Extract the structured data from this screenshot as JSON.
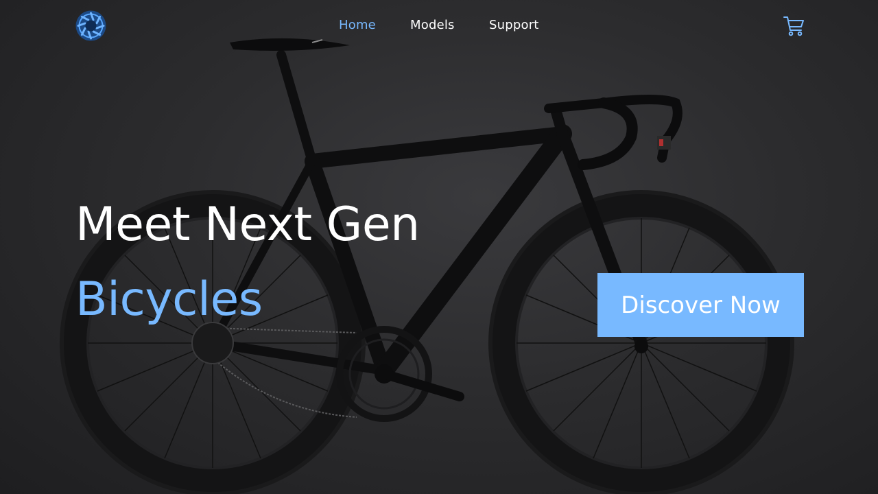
{
  "nav": {
    "items": [
      {
        "label": "Home",
        "active": true
      },
      {
        "label": "Models",
        "active": false
      },
      {
        "label": "Support",
        "active": false
      }
    ]
  },
  "icons": {
    "logo": "brand-logo-icon",
    "cart": "shopping-cart-icon"
  },
  "hero": {
    "headline": "Meet Next Gen",
    "headline_accent": "Bicycles",
    "cta_label": "Discover Now"
  },
  "colors": {
    "accent": "#78b9ff",
    "background": "#2a2a2c",
    "text": "#ffffff"
  }
}
